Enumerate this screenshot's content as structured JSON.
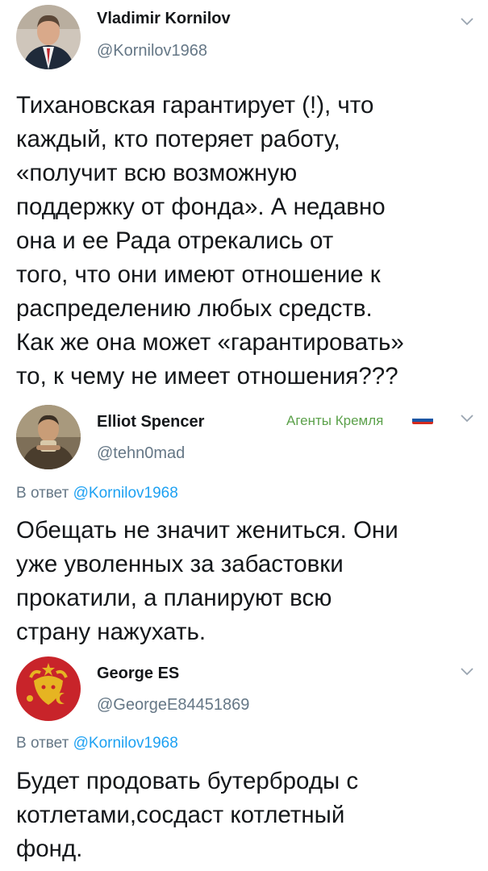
{
  "tweets": [
    {
      "name": "Vladimir Kornilov",
      "handle": "@Kornilov1968",
      "reply_prefix": "",
      "reply_to": "",
      "label": "",
      "body": [
        "Тихановская гарантирует (!), что",
        "каждый, кто потеряет работу,",
        "«получит всю возможную",
        "поддержку от фонда». А недавно",
        "она и ее Рада отрекались от",
        "того, что они имеют отношение к",
        "распределению любых средств.",
        "Как же она может «гарантировать»",
        "то, к чему не имеет отношения???"
      ]
    },
    {
      "name": "Elliot Spencer",
      "handle": "@tehn0mad",
      "reply_prefix": "В ответ ",
      "reply_to": "@Kornilov1968",
      "label": "Агенты Кремля",
      "body": [
        "Обещать не значит жениться. Они",
        "уже уволенных за забастовки",
        "прокатили, а планируют всю",
        "страну нажухать."
      ]
    },
    {
      "name": "George ES",
      "handle": "@GeorgeE84451869",
      "reply_prefix": "В ответ ",
      "reply_to": "@Kornilov1968",
      "label": "",
      "body": [
        "Будет продовать бутерброды с",
        "котлетами,сосдаст котлетный",
        "фонд."
      ]
    }
  ],
  "colors": {
    "text": "#14171a",
    "secondary": "#657786",
    "link": "#1da1f2",
    "label": "#5ca14b"
  },
  "icons": [
    "chevron-down-icon",
    "russia-flag-icon"
  ]
}
